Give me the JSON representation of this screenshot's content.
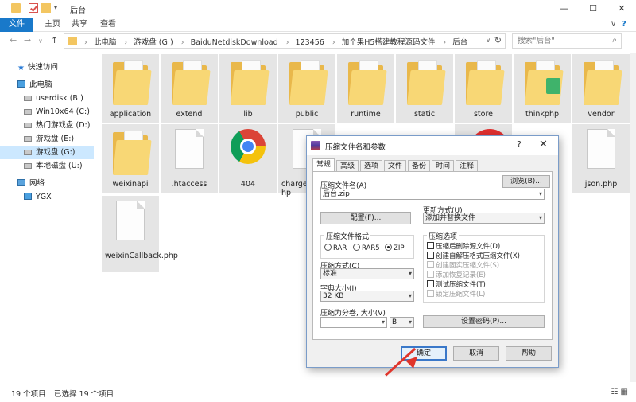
{
  "window": {
    "title": "后台",
    "minimize": "—",
    "maximize": "☐",
    "close": "✕"
  },
  "ribbon": {
    "tabs": [
      "文件",
      "主页",
      "共享",
      "查看"
    ],
    "collapse": "∨",
    "help": "?"
  },
  "address": {
    "back": "←",
    "forward": "→",
    "recent": "∨",
    "up": "↑",
    "crumbs": [
      "此电脑",
      "游戏盘 (G:)",
      "BaiduNetdiskDownload",
      "123456",
      "加个果H5搭建教程源码文件",
      "后台"
    ],
    "separator": "›",
    "dropdown": "∨",
    "refresh": "↻"
  },
  "search": {
    "placeholder": "搜索\"后台\""
  },
  "sidebar": [
    {
      "label": "快速访问",
      "icon": "star-icon"
    },
    {
      "label": "此电脑",
      "icon": "computer-icon"
    },
    {
      "label": "userdisk (B:)",
      "icon": "drive-icon"
    },
    {
      "label": "Win10x64 (C:)",
      "icon": "drive-icon"
    },
    {
      "label": "热门游戏盘 (D:)",
      "icon": "drive-icon"
    },
    {
      "label": "游戏盘 (E:)",
      "icon": "drive-icon"
    },
    {
      "label": "游戏盘 (G:)",
      "icon": "drive-icon"
    },
    {
      "label": "本地磁盘 (U:)",
      "icon": "drive-icon"
    },
    {
      "label": "网络",
      "icon": "network-icon"
    },
    {
      "label": "YGX",
      "icon": "computer-icon"
    }
  ],
  "files": [
    {
      "name": "application",
      "type": "folder"
    },
    {
      "name": "extend",
      "type": "folder"
    },
    {
      "name": "lib",
      "type": "folder"
    },
    {
      "name": "public",
      "type": "folder"
    },
    {
      "name": "runtime",
      "type": "folder"
    },
    {
      "name": "static",
      "type": "folder"
    },
    {
      "name": "store",
      "type": "folder"
    },
    {
      "name": "thinkphp",
      "type": "folder"
    },
    {
      "name": "vendor",
      "type": "folder"
    },
    {
      "name": "weixinapi",
      "type": "folder"
    },
    {
      "name": ".htaccess",
      "type": "file"
    },
    {
      "name": "404",
      "type": "chrome"
    },
    {
      "name": "chargea hp",
      "type": "file"
    },
    {
      "name": "json.php",
      "type": "file"
    },
    {
      "name": "weixinCallback.php",
      "type": "file"
    }
  ],
  "status": {
    "count": "19 个项目",
    "selected": "已选择 19 个项目"
  },
  "dialog": {
    "title": "压缩文件名和参数",
    "help": "?",
    "close": "✕",
    "tabs": [
      "常规",
      "高级",
      "选项",
      "文件",
      "备份",
      "时间",
      "注释"
    ],
    "archive_name_label": "压缩文件名(A)",
    "browse_button": "浏览(B)...",
    "archive_name_value": "后台.zip",
    "update_mode_label": "更新方式(U)",
    "update_mode_value": "添加并替换文件",
    "profiles_button": "配置(F)...",
    "format_group": "压缩文件格式",
    "formats": [
      "RAR",
      "RAR5",
      "ZIP"
    ],
    "format_selected": "ZIP",
    "options_group": "压缩选项",
    "options": [
      {
        "label": "压缩后删除源文件(D)",
        "enabled": true
      },
      {
        "label": "创建自解压格式压缩文件(X)",
        "enabled": true
      },
      {
        "label": "创建固实压缩文件(S)",
        "enabled": false
      },
      {
        "label": "添加恢复记录(E)",
        "enabled": false
      },
      {
        "label": "测试压缩文件(T)",
        "enabled": true
      },
      {
        "label": "锁定压缩文件(L)",
        "enabled": false
      }
    ],
    "method_label": "压缩方式(C)",
    "method_value": "标准",
    "dict_label": "字典大小(I)",
    "dict_value": "32 KB",
    "split_label": "压缩为分卷, 大小(V)",
    "split_value": "",
    "split_unit": "B",
    "password_button": "设置密码(P)...",
    "ok": "确定",
    "cancel": "取消",
    "help_button": "帮助"
  }
}
